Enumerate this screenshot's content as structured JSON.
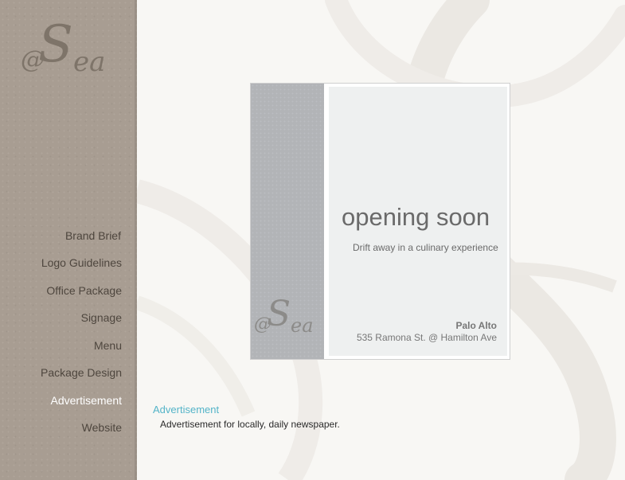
{
  "brand": {
    "logo_at": "@",
    "logo_s": "S",
    "logo_ea": "ea"
  },
  "nav": {
    "items": [
      {
        "label": "Brand Brief"
      },
      {
        "label": "Logo Guidelines"
      },
      {
        "label": "Office Package"
      },
      {
        "label": "Signage"
      },
      {
        "label": "Menu"
      },
      {
        "label": "Package Design"
      },
      {
        "label": "Advertisement"
      },
      {
        "label": "Website"
      }
    ],
    "active": "Advertisement"
  },
  "ad": {
    "headline": "opening soon",
    "tagline": "Drift away in a culinary experience",
    "city": "Palo Alto",
    "address": "535 Ramona St. @ Hamilton Ave"
  },
  "caption": {
    "title": "Advertisement",
    "text": "Advertisement for locally, daily newspaper."
  },
  "colors": {
    "sidebar": "#a89d92",
    "accent": "#54b4c8",
    "active_nav": "#ffffff"
  }
}
